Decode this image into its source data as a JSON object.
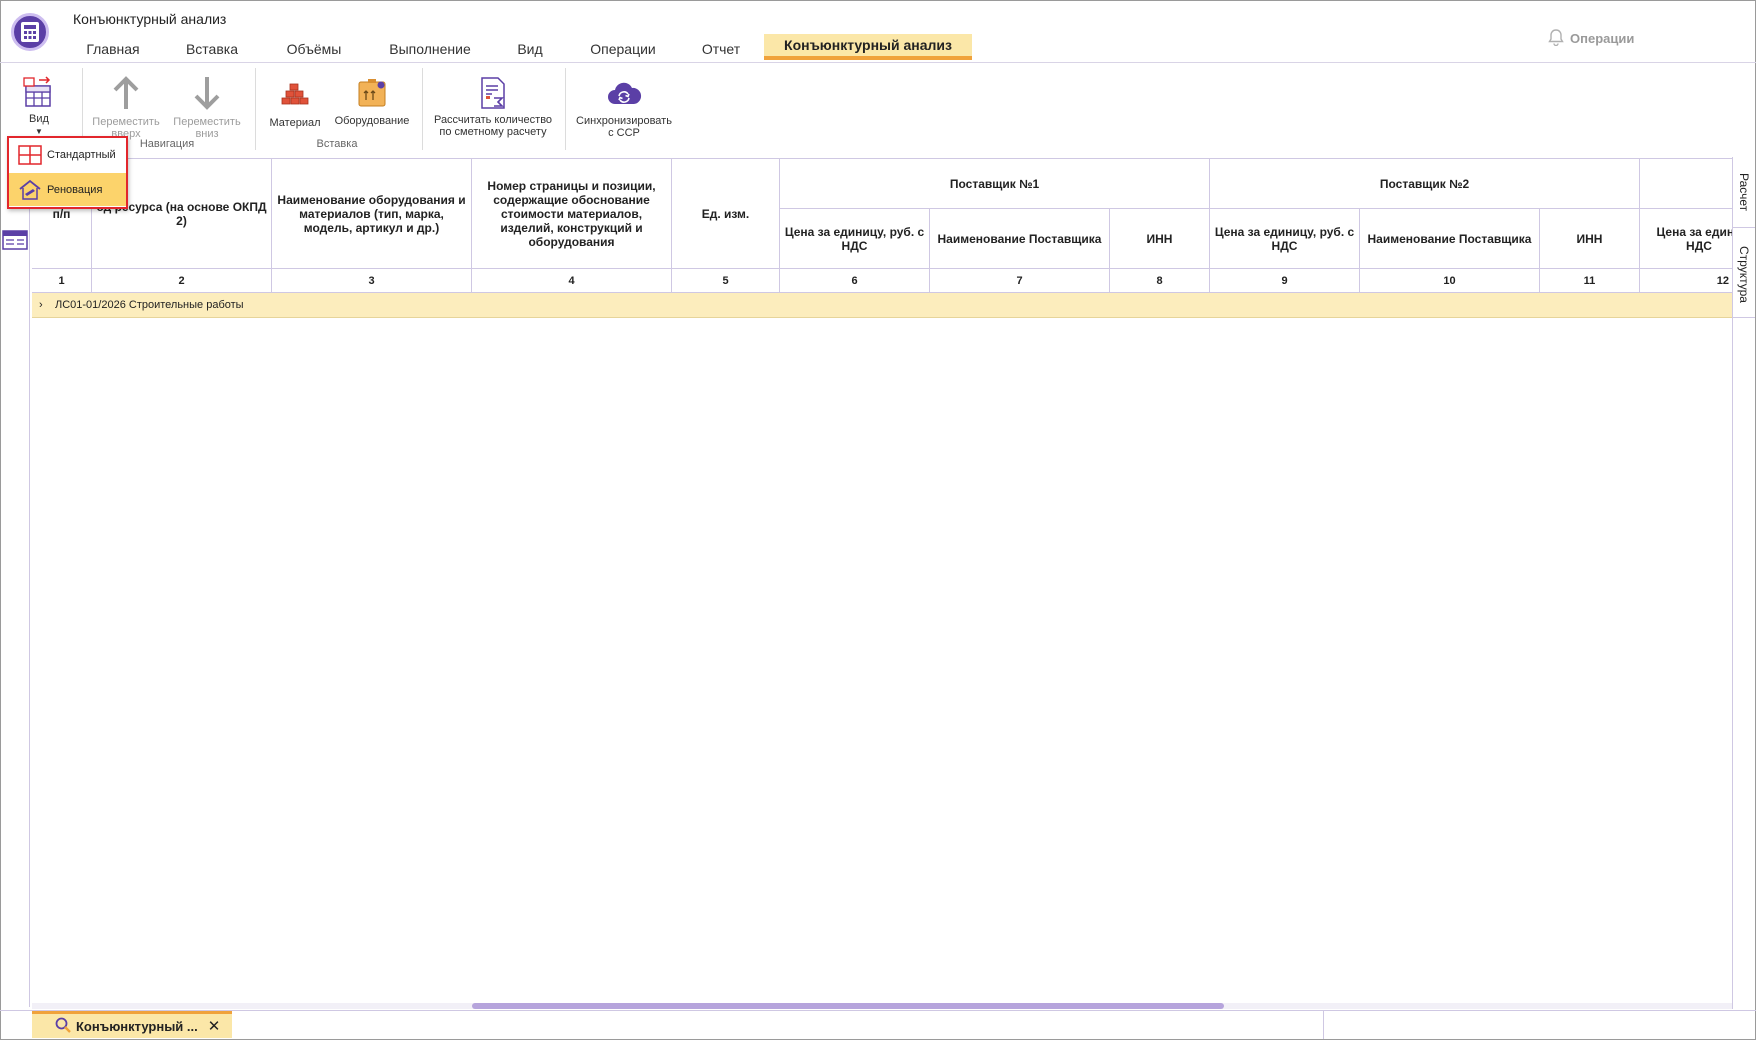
{
  "app": {
    "title": "Конъюнктурный анализ"
  },
  "tabs": [
    {
      "label": "Главная"
    },
    {
      "label": "Вставка"
    },
    {
      "label": "Объёмы"
    },
    {
      "label": "Выполнение"
    },
    {
      "label": "Вид"
    },
    {
      "label": "Операции"
    },
    {
      "label": "Отчет"
    },
    {
      "label": "Конъюнктурный анализ",
      "active": true
    }
  ],
  "notifications": {
    "label": "Операции"
  },
  "ribbon": {
    "view_label": "Вид",
    "move_up_label": "Переместить вверх",
    "move_up_l1": "Переместить",
    "move_up_l2": "вверх",
    "move_down_l1": "Переместить",
    "move_down_l2": "вниз",
    "nav_group": "Навигация",
    "material_label": "Материал",
    "equipment_label": "Оборудование",
    "insert_group": "Вставка",
    "calc_l1": "Рассчитать количество",
    "calc_l2": "по сметному расчету",
    "sync_l1": "Синхронизировать",
    "sync_l2": "с ССР"
  },
  "dropdown": {
    "items": [
      {
        "label": "Стандартный"
      },
      {
        "label": "Реновация",
        "highlighted": true
      }
    ]
  },
  "grid": {
    "headers": {
      "col1": "№ п/п",
      "col1_visible": "п/п",
      "col2": "од ресурса (на основе ОКПД 2)",
      "col3": "Наименование оборудования и материалов (тип, марка, модель, артикул и др.)",
      "col4": "Номер страницы и позиции, содержащие обоснование стоимости материалов, изделий, конструкций и оборудования",
      "col5": "Ед. изм.",
      "supplier1": "Поставщик №1",
      "supplier2": "Поставщик №2",
      "price": "Цена за единицу, руб. с НДС",
      "price_cut": "Цена за едини НДС",
      "supplier_name": "Наименование Поставщика",
      "inn": "ИНН"
    },
    "numbers": [
      "1",
      "2",
      "3",
      "4",
      "5",
      "6",
      "7",
      "8",
      "9",
      "10",
      "11",
      "12"
    ],
    "group_row": "ЛС01-01/2026 Строительные работы"
  },
  "right_panel": {
    "tab1": "Расчет",
    "tab2": "Структура"
  },
  "bottom_tab": {
    "label": "Конъюнктурный ..."
  },
  "colors": {
    "accent": "#5b3fa6",
    "active_tab": "#fbe7a8",
    "active_underline": "#f0a23b",
    "group_row": "#fcedbd",
    "highlight": "#fcd36b",
    "dropdown_border": "#e2262c"
  }
}
